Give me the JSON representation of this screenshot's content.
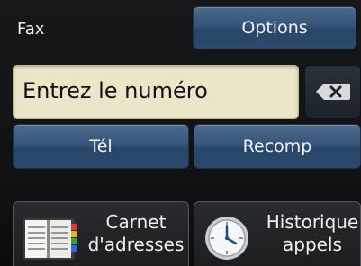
{
  "header": {
    "title": "Fax",
    "options_label": "Options"
  },
  "entry": {
    "placeholder": "Entrez le numéro"
  },
  "buttons": {
    "tel_label": "Tél",
    "recomp_label": "Recomp"
  },
  "shortcuts": [
    {
      "line1": "Carnet",
      "line2": "d'adresses",
      "icon": "address-book-icon"
    },
    {
      "line1": "Historique",
      "line2": "appels",
      "icon": "clock-icon"
    }
  ],
  "colors": {
    "button_blue": "#36557a",
    "entry_bg": "#ece6c9",
    "background": "#111214"
  }
}
